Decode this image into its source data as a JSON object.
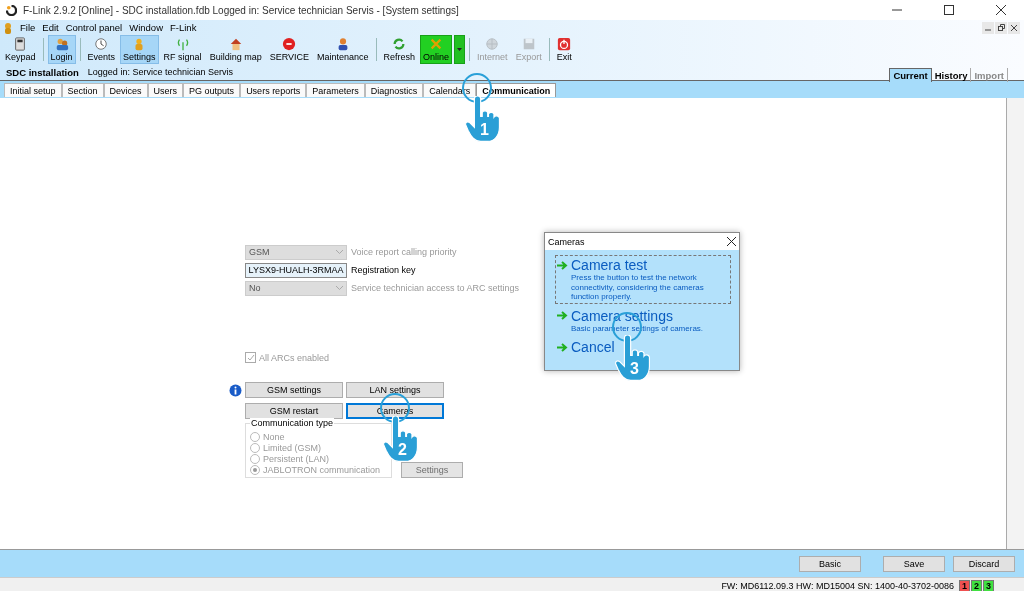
{
  "window": {
    "title": "F-Link 2.9.2 [Online] - SDC installation.fdb Logged in: Service technician Servis - [System settings]"
  },
  "menu": [
    "File",
    "Edit",
    "Control panel",
    "Window",
    "F-Link"
  ],
  "toolbar": [
    {
      "label": "Keypad",
      "kind": "button",
      "selected": false,
      "disabled": false
    },
    {
      "label": "Login",
      "kind": "button",
      "selected": true,
      "disabled": false
    },
    {
      "label": "Events",
      "kind": "button",
      "selected": false,
      "disabled": false
    },
    {
      "label": "Settings",
      "kind": "button",
      "selected": true,
      "disabled": false
    },
    {
      "label": "RF signal",
      "kind": "button",
      "selected": false,
      "disabled": false
    },
    {
      "label": "Building map",
      "kind": "button",
      "selected": false,
      "disabled": false
    },
    {
      "label": "SERVICE",
      "kind": "button",
      "selected": false,
      "disabled": false
    },
    {
      "label": "Maintenance",
      "kind": "button",
      "selected": false,
      "disabled": false
    },
    {
      "label": "Refresh",
      "kind": "button",
      "selected": false,
      "disabled": false
    },
    {
      "label": "Online",
      "kind": "split",
      "selected": false,
      "disabled": false
    },
    {
      "label": "Internet",
      "kind": "button",
      "selected": false,
      "disabled": true
    },
    {
      "label": "Export",
      "kind": "button",
      "selected": false,
      "disabled": true
    },
    {
      "label": "Exit",
      "kind": "button",
      "selected": false,
      "disabled": false
    }
  ],
  "info_bar": {
    "installation": "SDC installation",
    "user": "Logged in: Service technician Servis"
  },
  "view_tabs": [
    {
      "label": "Current",
      "selected": true,
      "disabled": false
    },
    {
      "label": "History",
      "selected": false,
      "disabled": false
    },
    {
      "label": "Import",
      "selected": false,
      "disabled": true
    }
  ],
  "tabs": [
    {
      "label": "Initial setup",
      "selected": false
    },
    {
      "label": "Section",
      "selected": false
    },
    {
      "label": "Devices",
      "selected": false
    },
    {
      "label": "Users",
      "selected": false
    },
    {
      "label": "PG outputs",
      "selected": false
    },
    {
      "label": "Users reports",
      "selected": false
    },
    {
      "label": "Parameters",
      "selected": false
    },
    {
      "label": "Diagnostics",
      "selected": false
    },
    {
      "label": "Calendars",
      "selected": false
    },
    {
      "label": "Communication",
      "selected": true
    }
  ],
  "form": {
    "fields": [
      {
        "kind": "select",
        "value": "GSM",
        "label": "Voice report calling priority",
        "disabled": true
      },
      {
        "kind": "text",
        "value": "LYSX9-HUALH-3RMAA",
        "label": "Registration key",
        "disabled": false
      },
      {
        "kind": "select",
        "value": "No",
        "label": "Service technician access to ARC settings",
        "disabled": true
      }
    ],
    "checkbox": {
      "label": "All ARCs enabled",
      "checked": true,
      "disabled": true
    },
    "buttons": [
      {
        "label": "GSM settings",
        "focused": false
      },
      {
        "label": "LAN settings",
        "focused": false
      },
      {
        "label": "GSM restart",
        "focused": false
      },
      {
        "label": "Cameras",
        "focused": true
      }
    ],
    "communication_type": {
      "title": "Communication type",
      "options": [
        {
          "label": "None",
          "selected": false
        },
        {
          "label": "Limited (GSM)",
          "selected": false
        },
        {
          "label": "Persistent (LAN)",
          "selected": false
        },
        {
          "label": "JABLOTRON communication",
          "selected": true
        }
      ],
      "disabled": true
    },
    "settings_button": {
      "label": "Settings",
      "disabled": true
    }
  },
  "dialog": {
    "title": "Cameras",
    "options": [
      {
        "title": "Camera test",
        "description": "Press the button to test the network connectivity, considering the cameras function properly.",
        "focused": true
      },
      {
        "title": "Camera settings",
        "description": "Basic parameter settings of cameras.",
        "focused": false
      },
      {
        "title": "Cancel",
        "focused": false
      }
    ]
  },
  "bottom_buttons": [
    "Basic",
    "Save",
    "Discard"
  ],
  "status_bar": {
    "text": "FW: MD6112.09.3 HW: MD15004 SN: 1400-40-3702-0086",
    "indicators": [
      {
        "label": "1",
        "color": "#f05050"
      },
      {
        "label": "2",
        "color": "#40e040"
      },
      {
        "label": "3",
        "color": "#40e040"
      }
    ]
  },
  "callouts": [
    {
      "number": "1"
    },
    {
      "number": "2"
    },
    {
      "number": "3"
    }
  ]
}
